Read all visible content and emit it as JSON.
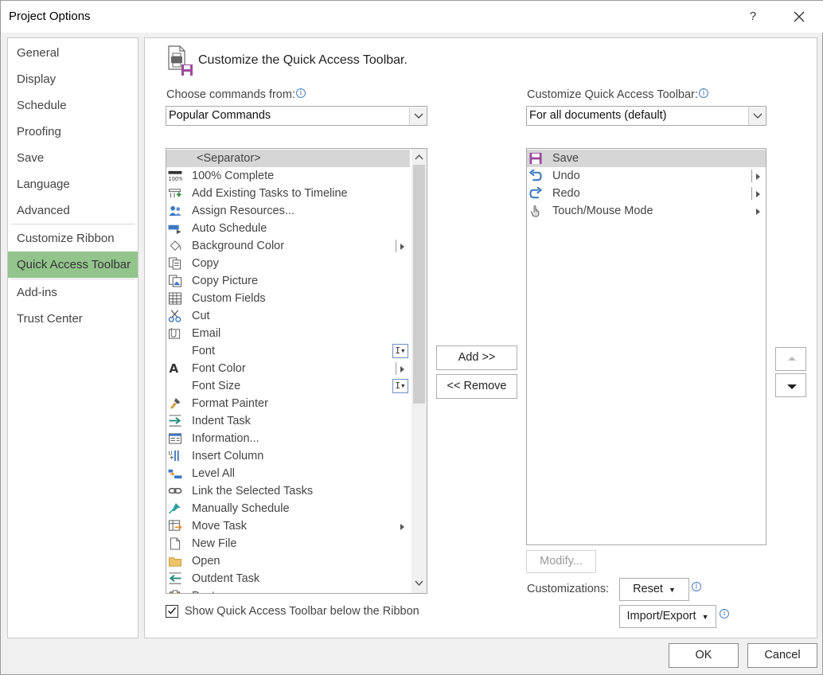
{
  "window": {
    "title": "Project Options",
    "help": "?",
    "close": "✕"
  },
  "nav": {
    "items": [
      {
        "label": "General"
      },
      {
        "label": "Display"
      },
      {
        "label": "Schedule"
      },
      {
        "label": "Proofing"
      },
      {
        "label": "Save"
      },
      {
        "label": "Language"
      },
      {
        "label": "Advanced"
      },
      {
        "label": "Customize Ribbon"
      },
      {
        "label": "Quick Access Toolbar",
        "selected": true
      },
      {
        "label": "Add-ins"
      },
      {
        "label": "Trust Center"
      }
    ]
  },
  "header": {
    "title": "Customize the Quick Access Toolbar."
  },
  "choose": {
    "label": "Choose commands from:",
    "value": "Popular Commands"
  },
  "customize": {
    "label": "Customize Quick Access Toolbar:",
    "value": "For all documents (default)"
  },
  "commands": [
    {
      "label": "<Separator>",
      "icon": "none",
      "selected": true
    },
    {
      "label": "100% Complete",
      "icon": "percent-bar-icon"
    },
    {
      "label": "Add Existing Tasks to Timeline",
      "icon": "timeline-add-icon"
    },
    {
      "label": "Assign Resources...",
      "icon": "people-icon"
    },
    {
      "label": "Auto Schedule",
      "icon": "auto-schedule-icon"
    },
    {
      "label": "Background Color",
      "icon": "paint-bucket-icon",
      "submenu": "split"
    },
    {
      "label": "Copy",
      "icon": "copy-icon"
    },
    {
      "label": "Copy Picture",
      "icon": "copy-picture-icon"
    },
    {
      "label": "Custom Fields",
      "icon": "grid-icon"
    },
    {
      "label": "Cut",
      "icon": "scissors-icon"
    },
    {
      "label": "Email",
      "icon": "email-attach-icon"
    },
    {
      "label": "Font",
      "icon": "none",
      "submenu": "ibeam"
    },
    {
      "label": "Font Color",
      "icon": "font-color-icon",
      "submenu": "split"
    },
    {
      "label": "Font Size",
      "icon": "none",
      "submenu": "ibeam"
    },
    {
      "label": "Format Painter",
      "icon": "brush-icon"
    },
    {
      "label": "Indent Task",
      "icon": "indent-icon"
    },
    {
      "label": "Information...",
      "icon": "info-card-icon"
    },
    {
      "label": "Insert Column",
      "icon": "insert-column-icon"
    },
    {
      "label": "Level All",
      "icon": "level-all-icon"
    },
    {
      "label": "Link the Selected Tasks",
      "icon": "link-icon"
    },
    {
      "label": "Manually Schedule",
      "icon": "pin-icon"
    },
    {
      "label": "Move Task",
      "icon": "move-task-icon",
      "submenu": "arrow"
    },
    {
      "label": "New File",
      "icon": "new-file-icon"
    },
    {
      "label": "Open",
      "icon": "folder-icon"
    },
    {
      "label": "Outdent Task",
      "icon": "outdent-icon"
    },
    {
      "label": "Paste",
      "icon": "paste-icon"
    }
  ],
  "toolbar_items": [
    {
      "label": "Save",
      "icon": "save-icon",
      "selected": true
    },
    {
      "label": "Undo",
      "icon": "undo-icon",
      "submenu": "split"
    },
    {
      "label": "Redo",
      "icon": "redo-icon",
      "submenu": "split"
    },
    {
      "label": "Touch/Mouse Mode",
      "icon": "touch-icon",
      "submenu": "arrow"
    }
  ],
  "buttons": {
    "add": "Add >>",
    "remove": "<< Remove",
    "modify": "Modify...",
    "reset": "Reset",
    "import_export": "Import/Export",
    "ok": "OK",
    "cancel": "Cancel"
  },
  "customizations_label": "Customizations:",
  "show_below": {
    "label": "Show Quick Access Toolbar below the Ribbon",
    "checked": true
  },
  "colors": {
    "nav_selected": "#92c48b",
    "list_selected": "#d6d6d6",
    "info": "#4a7fc0"
  }
}
